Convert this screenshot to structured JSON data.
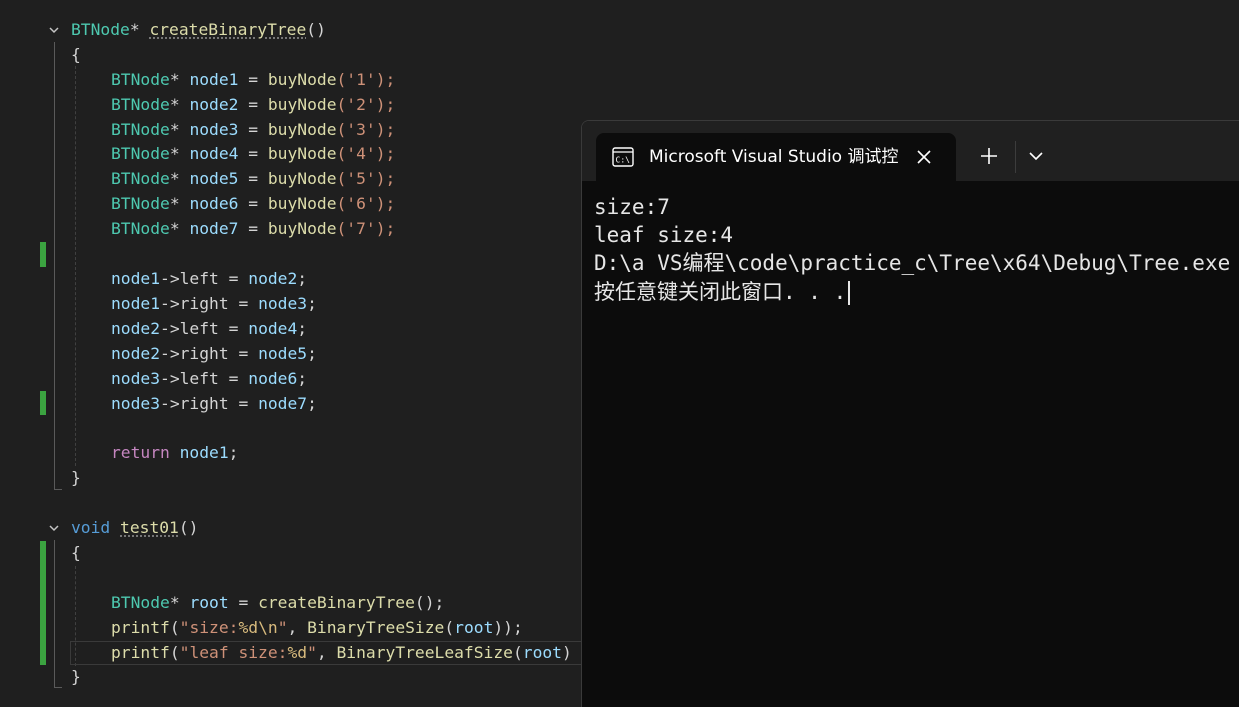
{
  "editor": {
    "fn1_header": {
      "type": "BTNode",
      "star": "*",
      "name": "createBinaryTree",
      "parens": "()"
    },
    "open_brace_1": "{",
    "decls": [
      {
        "type": "BTNode",
        "star": "* ",
        "var": "node1",
        "eq": " = ",
        "call": "buyNode",
        "arg": "('1');"
      },
      {
        "type": "BTNode",
        "star": "* ",
        "var": "node2",
        "eq": " = ",
        "call": "buyNode",
        "arg": "('2');"
      },
      {
        "type": "BTNode",
        "star": "* ",
        "var": "node3",
        "eq": " = ",
        "call": "buyNode",
        "arg": "('3');"
      },
      {
        "type": "BTNode",
        "star": "* ",
        "var": "node4",
        "eq": " = ",
        "call": "buyNode",
        "arg": "('4');"
      },
      {
        "type": "BTNode",
        "star": "* ",
        "var": "node5",
        "eq": " = ",
        "call": "buyNode",
        "arg": "('5');"
      },
      {
        "type": "BTNode",
        "star": "* ",
        "var": "node6",
        "eq": " = ",
        "call": "buyNode",
        "arg": "('6');"
      },
      {
        "type": "BTNode",
        "star": "* ",
        "var": "node7",
        "eq": " = ",
        "call": "buyNode",
        "arg": "('7');"
      }
    ],
    "links": [
      {
        "lhs": "node1",
        "arrow": "->",
        "field": "left",
        "eq": " = ",
        "rhs": "node2",
        "semi": ";"
      },
      {
        "lhs": "node1",
        "arrow": "->",
        "field": "right",
        "eq": " = ",
        "rhs": "node3",
        "semi": ";"
      },
      {
        "lhs": "node2",
        "arrow": "->",
        "field": "left",
        "eq": " = ",
        "rhs": "node4",
        "semi": ";"
      },
      {
        "lhs": "node2",
        "arrow": "->",
        "field": "right",
        "eq": " = ",
        "rhs": "node5",
        "semi": ";"
      },
      {
        "lhs": "node3",
        "arrow": "->",
        "field": "left",
        "eq": " = ",
        "rhs": "node6",
        "semi": ";"
      },
      {
        "lhs": "node3",
        "arrow": "->",
        "field": "right",
        "eq": " = ",
        "rhs": "node7",
        "semi": ";"
      }
    ],
    "return_stmt": {
      "kw": "return",
      "value": " node1",
      "semi": ";"
    },
    "close_brace_1": "}",
    "fn2_header": {
      "kw": "void",
      "name": "test01",
      "parens": "()"
    },
    "open_brace_2": "{",
    "root_decl": {
      "type": "BTNode",
      "star": "* ",
      "var": "root",
      "eq": " = ",
      "call": "createBinaryTree",
      "tail": "();"
    },
    "printf1": {
      "fn": "printf",
      "open": "(",
      "str": "\"size:",
      "fmt": "%d\\n",
      "strend": "\"",
      "comma": ", ",
      "call": "BinaryTreeSize",
      "p": "(",
      "arg": "root",
      "tail": "));"
    },
    "printf2": {
      "fn": "printf",
      "open": "(",
      "str": "\"leaf size:",
      "fmt": "%d",
      "strend": "\"",
      "comma": ", ",
      "call": "BinaryTreeLeafSize",
      "p": "(",
      "arg": "root",
      "tail": ")"
    },
    "close_brace_2": "}"
  },
  "console": {
    "tab_title": "Microsoft Visual Studio 调试控制台",
    "icons": {
      "tab": "terminal-icon",
      "close": "close-icon",
      "new_tab": "plus-icon",
      "dropdown": "chevron-down-icon"
    },
    "output": [
      "size:7",
      "leaf size:4",
      "D:\\a VS编程\\code\\practice_c\\Tree\\x64\\Debug\\Tree.exe",
      "按任意键关闭此窗口. . ."
    ]
  }
}
